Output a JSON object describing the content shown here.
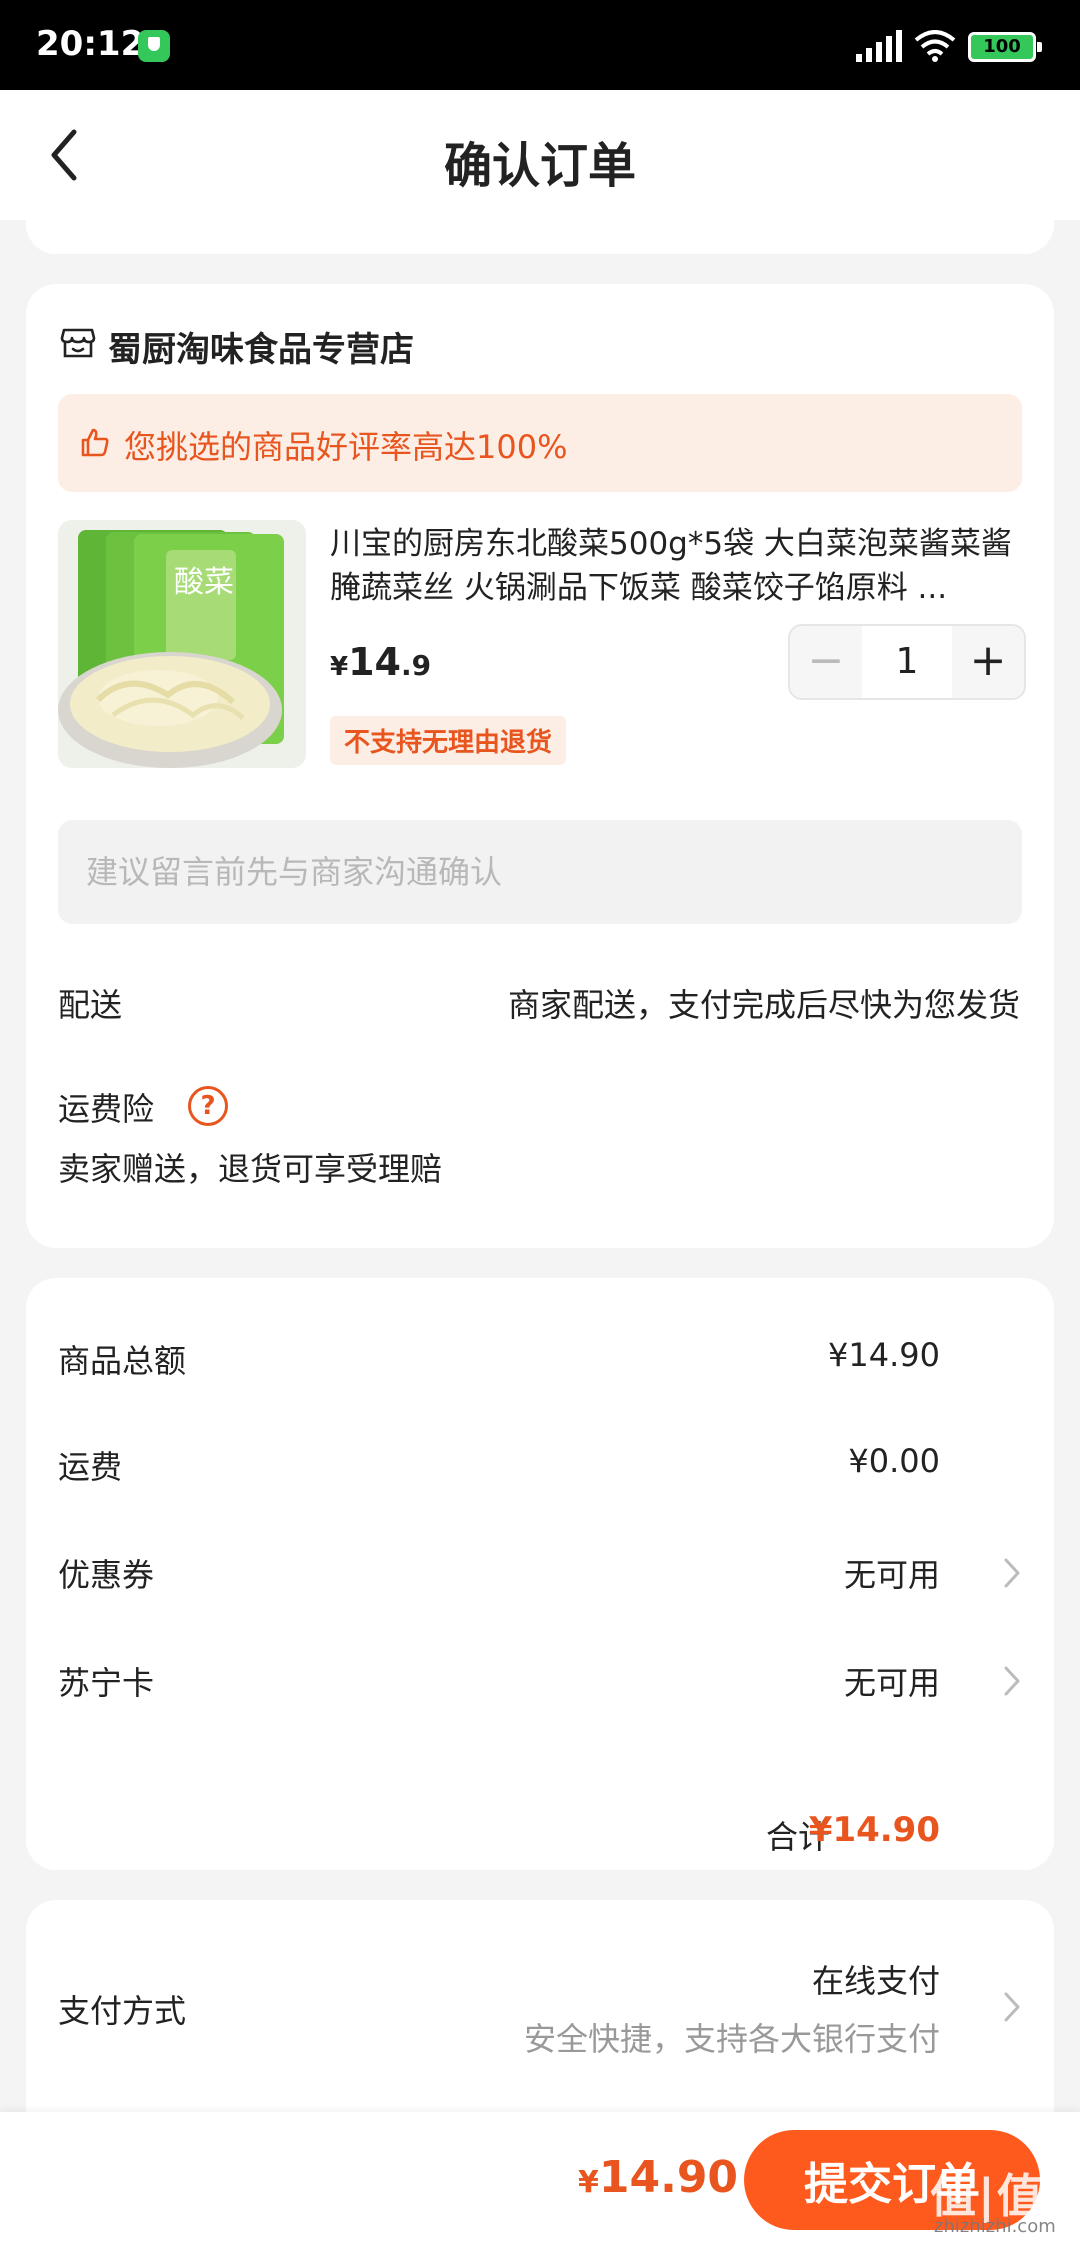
{
  "status_bar": {
    "time": "20:12",
    "battery": "100"
  },
  "header": {
    "title": "确认订单"
  },
  "shop": {
    "name": "蜀厨淘味食品专营店",
    "rating_banner": "您挑选的商品好评率高达100%"
  },
  "product": {
    "title": "川宝的厨房东北酸菜500g*5袋 大白菜泡菜酱菜酱腌蔬菜丝 火锅涮品下饭菜 酸菜饺子馅原料 ...",
    "price_symbol": "¥",
    "price_integer": "14",
    "price_decimal": ".9",
    "quantity": "1",
    "minus_label": "−",
    "plus_label": "+",
    "return_badge": "不支持无理由退货",
    "image_package_label": "酸菜"
  },
  "note": {
    "placeholder": "建议留言前先与商家沟通确认"
  },
  "delivery": {
    "label": "配送",
    "value": "商家配送，支付完成后尽快为您发货"
  },
  "shipping_insurance": {
    "label": "运费险",
    "help": "?",
    "description": "卖家赠送，退货可享受理赔"
  },
  "summary": {
    "goods_total_label": "商品总额",
    "goods_total_value": "¥14.90",
    "shipping_label": "运费",
    "shipping_value": "¥0.00",
    "coupon_label": "优惠券",
    "coupon_value": "无可用",
    "suning_card_label": "苏宁卡",
    "suning_card_value": "无可用",
    "total_label": "合计",
    "total_value": "¥14.90"
  },
  "payment": {
    "label": "支付方式",
    "method": "在线支付",
    "method_desc": "安全快捷，支持各大银行支付"
  },
  "bottom_bar": {
    "price_symbol": "¥",
    "price_amount": "14.90",
    "submit_label": "提交订单"
  },
  "watermark": {
    "main": "值|值|值",
    "sub": "zhizhizhi.com"
  },
  "colors": {
    "accent": "#ff5a1e",
    "price": "#e8551e",
    "banner_bg": "#fdeee5",
    "page_bg": "#f4f4f4"
  }
}
